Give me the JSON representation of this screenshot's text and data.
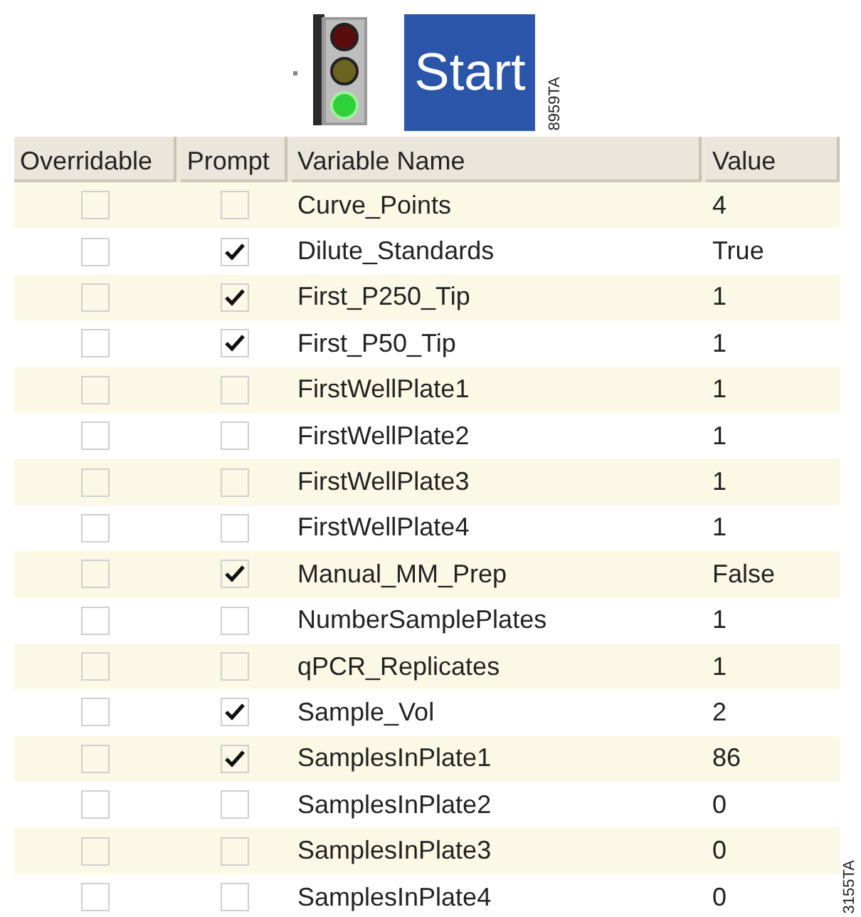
{
  "toolbar": {
    "traffic_light": [
      {
        "color": "#5a0d0d",
        "on": false
      },
      {
        "color": "#6b6420",
        "on": false
      },
      {
        "color": "#2fd13a",
        "on": true
      }
    ],
    "start_button": "Start",
    "figure_code": "8959TA"
  },
  "table": {
    "columns": [
      "Overridable",
      "Prompt",
      "Variable Name",
      "Value"
    ],
    "rows": [
      {
        "overridable": false,
        "prompt": false,
        "name": "Curve_Points",
        "value": "4"
      },
      {
        "overridable": false,
        "prompt": true,
        "name": "Dilute_Standards",
        "value": "True"
      },
      {
        "overridable": false,
        "prompt": true,
        "name": "First_P250_Tip",
        "value": "1"
      },
      {
        "overridable": false,
        "prompt": true,
        "name": "First_P50_Tip",
        "value": "1"
      },
      {
        "overridable": false,
        "prompt": false,
        "name": "FirstWellPlate1",
        "value": "1"
      },
      {
        "overridable": false,
        "prompt": false,
        "name": "FirstWellPlate2",
        "value": "1"
      },
      {
        "overridable": false,
        "prompt": false,
        "name": "FirstWellPlate3",
        "value": "1"
      },
      {
        "overridable": false,
        "prompt": false,
        "name": "FirstWellPlate4",
        "value": "1"
      },
      {
        "overridable": false,
        "prompt": true,
        "name": "Manual_MM_Prep",
        "value": "False"
      },
      {
        "overridable": false,
        "prompt": false,
        "name": "NumberSamplePlates",
        "value": "1"
      },
      {
        "overridable": false,
        "prompt": false,
        "name": "qPCR_Replicates",
        "value": "1"
      },
      {
        "overridable": false,
        "prompt": true,
        "name": "Sample_Vol",
        "value": "2"
      },
      {
        "overridable": false,
        "prompt": true,
        "name": "SamplesInPlate1",
        "value": "86"
      },
      {
        "overridable": false,
        "prompt": false,
        "name": "SamplesInPlate2",
        "value": "0"
      },
      {
        "overridable": false,
        "prompt": false,
        "name": "SamplesInPlate3",
        "value": "0"
      },
      {
        "overridable": false,
        "prompt": false,
        "name": "SamplesInPlate4",
        "value": "0"
      }
    ]
  },
  "figure_code": "3155TA"
}
